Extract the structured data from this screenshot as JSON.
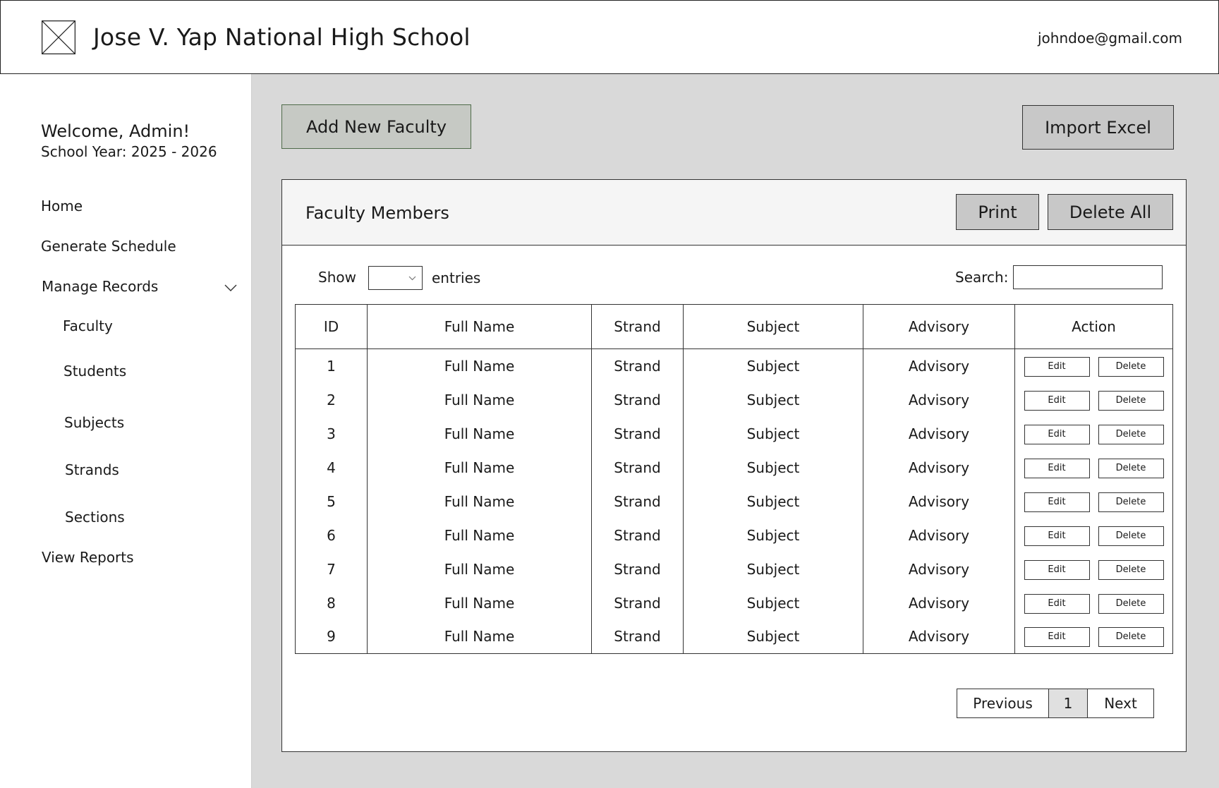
{
  "header": {
    "school_name": "Jose V. Yap National High School",
    "user_email": "johndoe@gmail.com"
  },
  "sidebar": {
    "welcome": "Welcome, Admin!",
    "school_year": "School Year: 2025 - 2026",
    "items": [
      {
        "label": "Home"
      },
      {
        "label": "Generate Schedule"
      },
      {
        "label": "Manage Records"
      },
      {
        "label": "Faculty"
      },
      {
        "label": "Students"
      },
      {
        "label": "Subjects"
      },
      {
        "label": "Strands"
      },
      {
        "label": "Sections"
      },
      {
        "label": "View Reports"
      }
    ]
  },
  "toolbar": {
    "add_label": "Add New Faculty",
    "import_label": "Import Excel"
  },
  "card": {
    "title": "Faculty Members",
    "print_label": "Print",
    "delete_all_label": "Delete All",
    "show_label": "Show",
    "entries_value": "",
    "entries_label": "entries",
    "search_label": "Search:",
    "search_value": ""
  },
  "table": {
    "headers": [
      "ID",
      "Full Name",
      "Strand",
      "Subject",
      "Advisory",
      "Action"
    ],
    "rows": [
      {
        "id": "1",
        "full_name": "Full Name",
        "strand": "Strand",
        "subject": "Subject",
        "advisory": "Advisory"
      },
      {
        "id": "2",
        "full_name": "Full Name",
        "strand": "Strand",
        "subject": "Subject",
        "advisory": "Advisory"
      },
      {
        "id": "3",
        "full_name": "Full Name",
        "strand": "Strand",
        "subject": "Subject",
        "advisory": "Advisory"
      },
      {
        "id": "4",
        "full_name": "Full Name",
        "strand": "Strand",
        "subject": "Subject",
        "advisory": "Advisory"
      },
      {
        "id": "5",
        "full_name": "Full Name",
        "strand": "Strand",
        "subject": "Subject",
        "advisory": "Advisory"
      },
      {
        "id": "6",
        "full_name": "Full Name",
        "strand": "Strand",
        "subject": "Subject",
        "advisory": "Advisory"
      },
      {
        "id": "7",
        "full_name": "Full Name",
        "strand": "Strand",
        "subject": "Subject",
        "advisory": "Advisory"
      },
      {
        "id": "8",
        "full_name": "Full Name",
        "strand": "Strand",
        "subject": "Subject",
        "advisory": "Advisory"
      },
      {
        "id": "9",
        "full_name": "Full Name",
        "strand": "Strand",
        "subject": "Subject",
        "advisory": "Advisory"
      }
    ],
    "edit_label": "Edit",
    "delete_label": "Delete"
  },
  "pagination": {
    "prev_label": "Previous",
    "page": "1",
    "next_label": "Next"
  },
  "icons": {
    "logo": "image-placeholder-icon",
    "manage_records_toggle": "chevron-down-icon",
    "entries_select": "chevron-down-icon"
  }
}
